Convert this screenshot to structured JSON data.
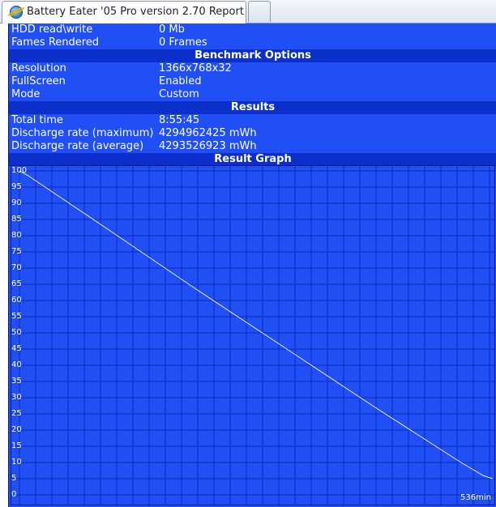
{
  "tab": {
    "title": "Battery Eater '05 Pro version 2.70 Report"
  },
  "info_rows": [
    {
      "label": "HDD read\\write",
      "value": "0 Mb"
    },
    {
      "label": "Fames Rendered",
      "value": "0 Frames"
    }
  ],
  "benchmark": {
    "header": "Benchmark Options",
    "rows": [
      {
        "label": "Resolution",
        "value": "1366x768x32"
      },
      {
        "label": "FullScreen",
        "value": "Enabled"
      },
      {
        "label": "Mode",
        "value": "Custom"
      }
    ]
  },
  "results": {
    "header": "Results",
    "rows": [
      {
        "label": "Total time",
        "value": "8:55:45"
      },
      {
        "label": "Discharge rate (maximum)",
        "value": "4294962425 mWh"
      },
      {
        "label": "Discharge rate (average)",
        "value": "4293526923 mWh"
      }
    ]
  },
  "graph": {
    "header": "Result Graph"
  },
  "colors": {
    "background": "#1f4ff5",
    "header": "#0d2fc9",
    "grid": "#0b2ab3",
    "line": "#e8eeff"
  },
  "chart_data": {
    "type": "line",
    "title": "Result Graph",
    "x_end_label": "536min",
    "x": [
      0,
      536
    ],
    "y_ticks": [
      "0",
      "5",
      "10",
      "15",
      "20",
      "25",
      "30",
      "35",
      "40",
      "45",
      "50",
      "55",
      "60",
      "65",
      "70",
      "75",
      "80",
      "85",
      "90",
      "95",
      "100"
    ],
    "ylim": [
      0,
      100
    ],
    "xlim": [
      0,
      536
    ],
    "grid": true,
    "series": [
      {
        "x": [
          0,
          10,
          100,
          200,
          300,
          400,
          500,
          525,
          530,
          536
        ],
        "y": [
          100,
          98.5,
          82,
          63.5,
          45.5,
          27.5,
          10,
          6,
          5.5,
          5
        ]
      }
    ]
  }
}
